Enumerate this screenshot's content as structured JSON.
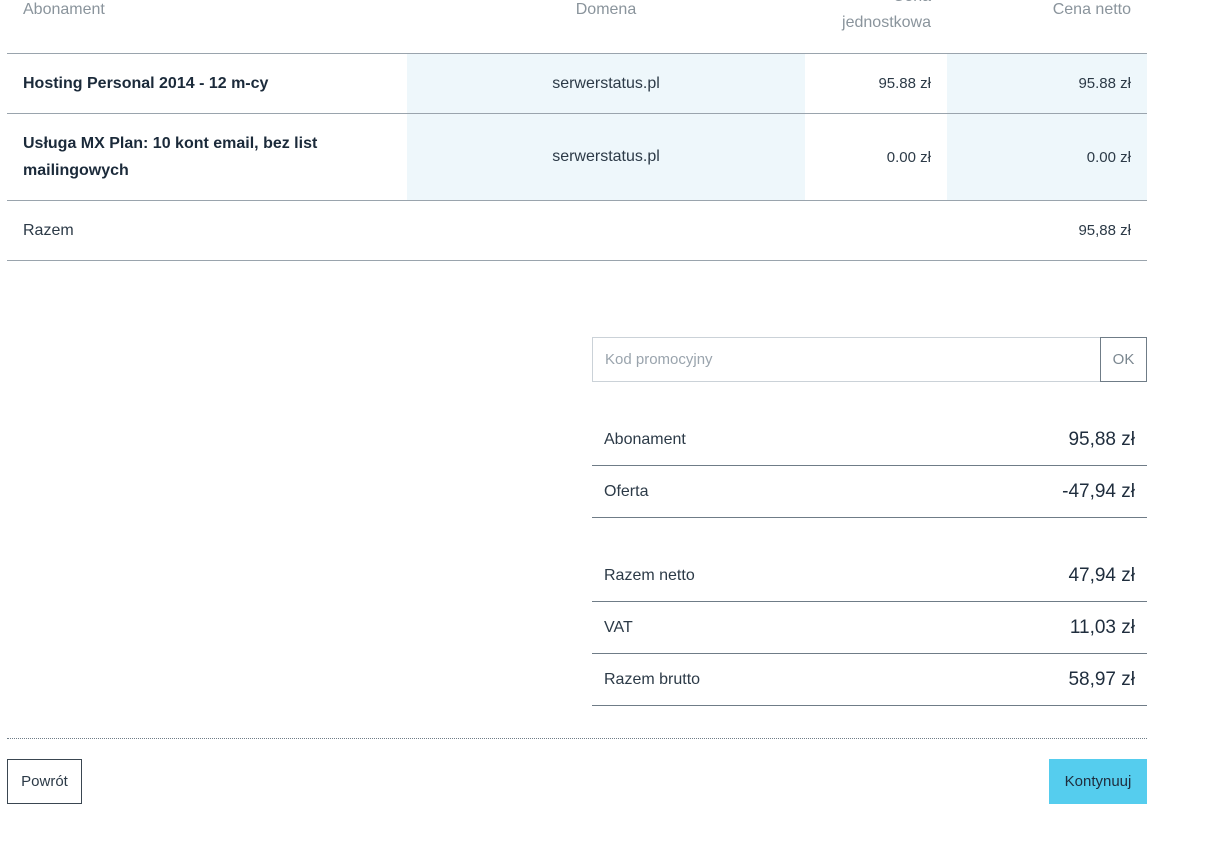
{
  "table": {
    "headers": {
      "subscription": "Abonament",
      "domain": "Domena",
      "unit_price": "Cena\njednostkowa",
      "net_price": "Cena netto"
    },
    "rows": [
      {
        "name": "Hosting Personal 2014 - 12 m-cy",
        "domain": "serwerstatus.pl",
        "unit_price": "95.88 zł",
        "net_price": "95.88 zł"
      },
      {
        "name": "Usługa MX Plan: 10 kont email, bez list mailingowych",
        "domain": "serwerstatus.pl",
        "unit_price": "0.00 zł",
        "net_price": "0.00 zł"
      }
    ],
    "total": {
      "label": "Razem",
      "value": "95,88 zł"
    }
  },
  "promo": {
    "placeholder": "Kod promocyjny",
    "value": "",
    "ok_label": "OK"
  },
  "summary": {
    "subscription_label": "Abonament",
    "subscription_value": "95,88 zł",
    "offer_label": "Oferta",
    "offer_value": "-47,94 zł",
    "net_label": "Razem netto",
    "net_value": "47,94 zł",
    "vat_label": "VAT",
    "vat_value": "11,03 zł",
    "gross_label": "Razem brutto",
    "gross_value": "58,97 zł"
  },
  "footer": {
    "back_label": "Powrót",
    "continue_label": "Kontynuuj"
  },
  "colors": {
    "accent": "#55cdee",
    "cell_highlight": "#eef7fb"
  }
}
